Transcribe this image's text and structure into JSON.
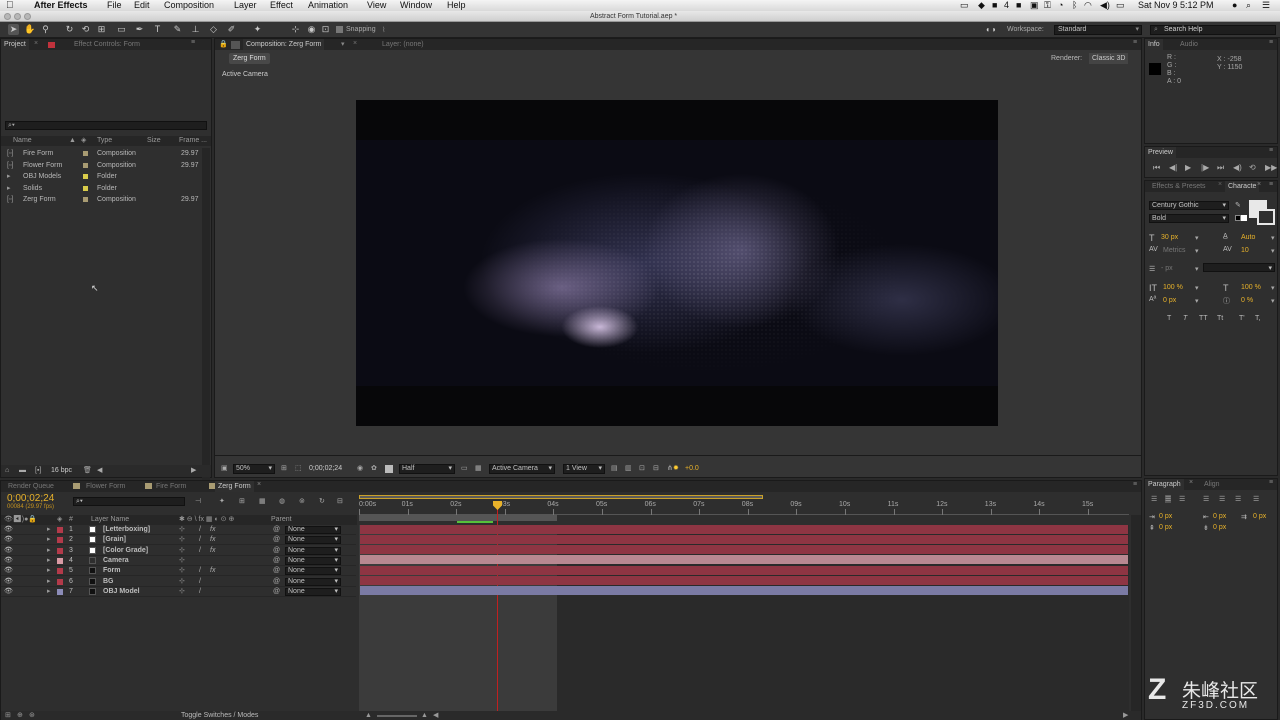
{
  "menubar": {
    "app": "After Effects",
    "items": [
      "File",
      "Edit",
      "Composition",
      "Layer",
      "Effect",
      "Animation",
      "View",
      "Window",
      "Help"
    ],
    "clock": "Sat Nov 9  5:12 PM",
    "status_num": "4"
  },
  "window_title": "Abstract Form Tutorial.aep *",
  "toolbar": {
    "snapping": "Snapping",
    "workspace_label": "Workspace:",
    "workspace_value": "Standard",
    "search_placeholder": "Search Help"
  },
  "project_panel": {
    "tabs": [
      "Project",
      "Effect Controls: Form"
    ],
    "search_icon": "search-icon",
    "columns": [
      "Name",
      "Type",
      "Size",
      "Frame ..."
    ],
    "items": [
      {
        "name": "Fire Form",
        "type": "Composition",
        "frame": "29.97",
        "kind": "comp",
        "color": "#a89b72"
      },
      {
        "name": "Flower Form",
        "type": "Composition",
        "frame": "29.97",
        "kind": "comp",
        "color": "#a89b72"
      },
      {
        "name": "OBJ Models",
        "type": "Folder",
        "frame": "",
        "kind": "folder",
        "color": "#d9cc4a"
      },
      {
        "name": "Solids",
        "type": "Folder",
        "frame": "",
        "kind": "folder",
        "color": "#d9cc4a"
      },
      {
        "name": "Zerg Form",
        "type": "Composition",
        "frame": "29.97",
        "kind": "comp",
        "color": "#a89b72"
      }
    ],
    "bpc": "16 bpc"
  },
  "comp_panel": {
    "tab": "Composition: Zerg Form",
    "layer_tab": "Layer: (none)",
    "breadcrumb": "Zerg Form",
    "renderer_label": "Renderer:",
    "renderer_value": "Classic 3D",
    "view_label": "Active Camera",
    "zoom": "50%",
    "timecode": "0;00;02;24",
    "resolution": "Half",
    "camera": "Active Camera",
    "views": "1 View",
    "exposure": "+0.0"
  },
  "info_panel": {
    "tabs": [
      "Info",
      "Audio"
    ],
    "rgba": [
      "R :",
      "G :",
      "B :",
      "A : 0"
    ],
    "x": "X : -258",
    "y": "Y : 1150"
  },
  "preview_panel": {
    "tab": "Preview"
  },
  "character_panel": {
    "tabs": [
      "Effects & Presets",
      "Characte"
    ],
    "font": "Century Gothic",
    "style": "Bold",
    "size": "30 px",
    "leading": "Auto",
    "kerning": "Metrics",
    "tracking": "10",
    "stroke": "- px",
    "vscale": "100 %",
    "hscale": "100 %",
    "baseline": "0 px",
    "tsume": "0 %",
    "styles": [
      "T",
      "T",
      "TT",
      "Tt",
      "T'",
      "T,"
    ]
  },
  "paragraph_panel": {
    "tabs": [
      "Paragraph",
      "Align"
    ],
    "values": [
      "0 px",
      "0 px",
      "0 px",
      "0 px",
      "0 px"
    ]
  },
  "timeline": {
    "tabs": [
      "Render Queue",
      "Flower Form",
      "Fire Form",
      "Zerg Form"
    ],
    "timecode": "0;00;02;24",
    "frames": "00084 (29.97 fps)",
    "col_layer": "Layer Name",
    "col_parent": "Parent",
    "ruler": [
      "0:00s",
      "01s",
      "02s",
      "03s",
      "04s",
      "05s",
      "06s",
      "07s",
      "08s",
      "09s",
      "10s",
      "11s",
      "12s",
      "13s",
      "14s",
      "15s"
    ],
    "layers": [
      {
        "num": "1",
        "name": "[Letterboxing]",
        "parent": "None",
        "color": "#b33a4a",
        "fx": true,
        "bar": "#8e3543"
      },
      {
        "num": "2",
        "name": "[Grain]",
        "parent": "None",
        "color": "#b33a4a",
        "fx": true,
        "bar": "#8e3543"
      },
      {
        "num": "3",
        "name": "[Color Grade]",
        "parent": "None",
        "color": "#b33a4a",
        "fx": true,
        "bar": "#8e3543"
      },
      {
        "num": "4",
        "name": "Camera",
        "parent": "None",
        "color": "#d99aa4",
        "fx": false,
        "bar": "#b88891"
      },
      {
        "num": "5",
        "name": "Form",
        "parent": "None",
        "color": "#b33a4a",
        "fx": true,
        "bar": "#8e3543"
      },
      {
        "num": "6",
        "name": "BG",
        "parent": "None",
        "color": "#b33a4a",
        "fx": false,
        "bar": "#8e3543"
      },
      {
        "num": "7",
        "name": "OBJ Model",
        "parent": "None",
        "color": "#8c8cb8",
        "fx": false,
        "bar": "#7a7aa4"
      }
    ],
    "toggle": "Toggle Switches / Modes"
  },
  "watermark": {
    "brand": "朱峰社区",
    "url": "ZF3D.COM"
  }
}
